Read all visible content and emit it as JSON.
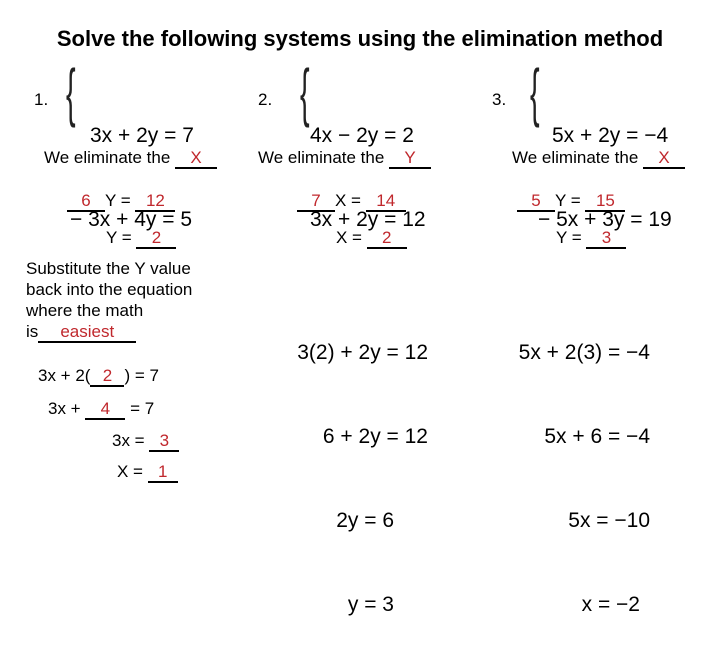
{
  "title": "Solve the following systems using the elimination method",
  "colors": {
    "answer": "#c0282d",
    "text": "#000000"
  },
  "problems": [
    {
      "number": "1.",
      "equations": [
        "3x + 2y = 7",
        "− 3x + 4y = 5"
      ],
      "eliminate_label": "We eliminate the",
      "eliminate_answer": "X",
      "step1": {
        "coef": "6",
        "var_eq": "Y =",
        "rhs": "12"
      },
      "step2": {
        "lhs": "Y =",
        "rhs": "2"
      }
    },
    {
      "number": "2.",
      "equations": [
        "4x − 2y = 2",
        "3x + 2y = 12"
      ],
      "eliminate_label": "We eliminate the",
      "eliminate_answer": "Y",
      "step1": {
        "coef": "7",
        "var_eq": "X =",
        "rhs": "14"
      },
      "step2": {
        "lhs": "X =",
        "rhs": "2"
      },
      "work": [
        "3(2) + 2y = 12",
        "6 + 2y = 12",
        "2y = 6",
        "y = 3"
      ]
    },
    {
      "number": "3.",
      "equations": [
        "5x + 2y = −4",
        "− 5x + 3y = 19"
      ],
      "eliminate_label": "We eliminate the",
      "eliminate_answer": "X",
      "step1": {
        "coef": "5",
        "var_eq": "Y =",
        "rhs": "15"
      },
      "step2": {
        "lhs": "Y =",
        "rhs": "3"
      },
      "work": [
        "5x + 2(3) = −4",
        "5x + 6 = −4",
        "5x = −10",
        "x = −2"
      ]
    }
  ],
  "substitute": {
    "text_lines": [
      "Substitute the Y value",
      "back into the equation",
      "where the math"
    ],
    "is_label": "is",
    "is_answer": "easiest",
    "steps": [
      {
        "pre": "3x + 2(",
        "ans": "2",
        "post": ") = 7"
      },
      {
        "pre": "3x + ",
        "ans": "4",
        "post": " = 7"
      },
      {
        "pre": "3x = ",
        "ans": "3",
        "post": ""
      },
      {
        "pre": "X = ",
        "ans": "1",
        "post": ""
      }
    ]
  }
}
